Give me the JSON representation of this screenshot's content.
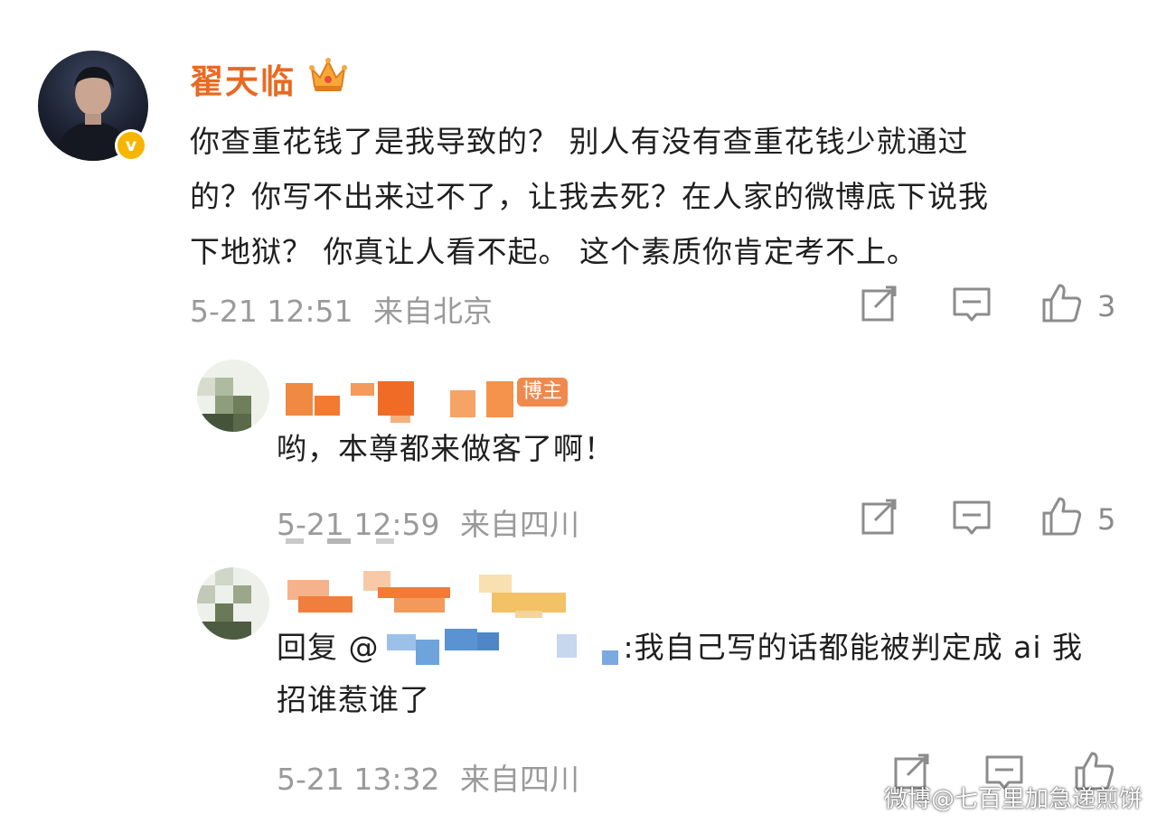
{
  "main_comment": {
    "username": "翟天临",
    "verified_mark": "v",
    "lines": [
      "你查重花钱了是我导致的？ 别人有没有查重花钱少就通过",
      "的？你写不出来过不了，让我去死？在人家的微博底下说我",
      "下地狱？  你真让人看不起。 这个素质你肯定考不上。"
    ],
    "time": "5-21 12:51",
    "source": "来自北京",
    "likes": "3"
  },
  "reply_1": {
    "badge": "博主",
    "text": "哟，本尊都来做客了啊！",
    "time": "5-21 12:59",
    "source": "来自四川",
    "likes": "5"
  },
  "reply_2": {
    "text_prefix": "回复 @",
    "text_suffix": ":我自己写的话都能被判定成 ai 我",
    "text_line2": "招谁惹谁了",
    "time": "5-21 13:32",
    "source": "来自四川"
  },
  "watermark": "微博@七百里加急递煎饼",
  "icons": {
    "crown": "crown-icon",
    "verified": "verified-icon",
    "repost": "repost-icon",
    "comment": "comment-icon",
    "like": "like-icon"
  },
  "colors": {
    "username": "#e86a22",
    "verified": "#f7b500",
    "badge": "#f0894e",
    "meta": "#9a9a9a",
    "icon": "#8c8c8c"
  }
}
